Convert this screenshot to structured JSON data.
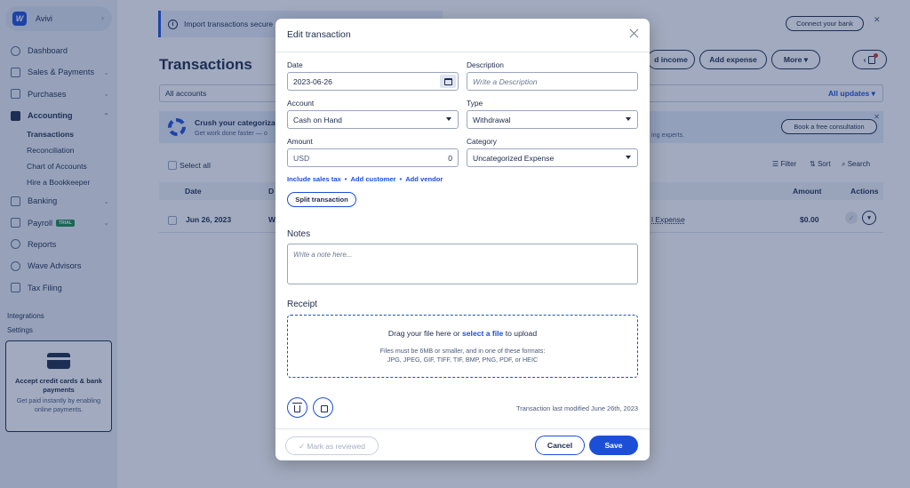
{
  "sidebar": {
    "brand_name": "Avivi",
    "items": [
      {
        "label": "Dashboard",
        "icon": "dashboard-icon"
      },
      {
        "label": "Sales & Payments",
        "icon": "sales-icon"
      },
      {
        "label": "Purchases",
        "icon": "purchases-icon"
      },
      {
        "label": "Accounting",
        "icon": "scale-icon"
      },
      {
        "label": "Banking",
        "icon": "bank-icon"
      },
      {
        "label": "Payroll",
        "icon": "payroll-icon",
        "badge": "TRIAL"
      },
      {
        "label": "Reports",
        "icon": "reports-icon"
      },
      {
        "label": "Wave Advisors",
        "icon": "advisors-icon"
      },
      {
        "label": "Tax Filing",
        "icon": "tax-icon"
      }
    ],
    "accounting_sub": [
      "Transactions",
      "Reconciliation",
      "Chart of Accounts",
      "Hire a Bookkeeper"
    ],
    "integrations_label": "Integrations",
    "settings_label": "Settings",
    "promo": {
      "title": "Accept credit cards & bank payments",
      "desc": "Get paid instantly by enabling online payments."
    }
  },
  "page": {
    "banner_text": "Import transactions secure",
    "connect_bank": "Connect your bank",
    "title": "Transactions",
    "add_income": "d income",
    "add_expense": "Add expense",
    "more": "More ▾",
    "accounts_filter": "All accounts",
    "all_updates": "All updates ▾",
    "crush_title": "Crush your categorizat",
    "crush_desc": "Get work done faster — o",
    "crush_right": "ing experts.",
    "book_consultation": "Book a free consultation",
    "select_all": "Select all",
    "filter": "Filter",
    "sort": "Sort",
    "search": "Search",
    "columns": {
      "date": "Date",
      "desc_initial": "D",
      "amount": "Amount",
      "actions": "Actions"
    },
    "row": {
      "date": "Jun 26, 2023",
      "desc_initial": "W",
      "category": "l Expense",
      "amount": "$0.00"
    }
  },
  "modal": {
    "title": "Edit transaction",
    "date_label": "Date",
    "date_value": "2023-06-26",
    "description_label": "Description",
    "description_placeholder": "Write a Description",
    "account_label": "Account",
    "account_value": "Cash on Hand",
    "type_label": "Type",
    "type_value": "Withdrawal",
    "amount_label": "Amount",
    "amount_currency": "USD",
    "amount_value": "0",
    "category_label": "Category",
    "category_value": "Uncategorized Expense",
    "links": [
      "Include sales tax",
      "Add customer",
      "Add vendor"
    ],
    "split_button": "Split transaction",
    "notes_label": "Notes",
    "notes_placeholder": "Write a note here...",
    "receipt_label": "Receipt",
    "drop_text_before": "Drag your file here or ",
    "drop_text_link": "select a file",
    "drop_text_after": " to upload",
    "file_rules_1": "Files must be 6MB or smaller, and in one of these formats:",
    "file_rules_2": "JPG, JPEG, GIF, TIFF, TIF, BMP, PNG, PDF, or HEIC",
    "last_modified": "Transaction last modified June 26th, 2023",
    "mark_reviewed": "✓ Mark as reviewed",
    "cancel": "Cancel",
    "save": "Save"
  },
  "colors": {
    "accent": "#1c4fd8",
    "navy": "#1c2a4a",
    "overlay": "rgba(30,52,100,0.42)"
  }
}
